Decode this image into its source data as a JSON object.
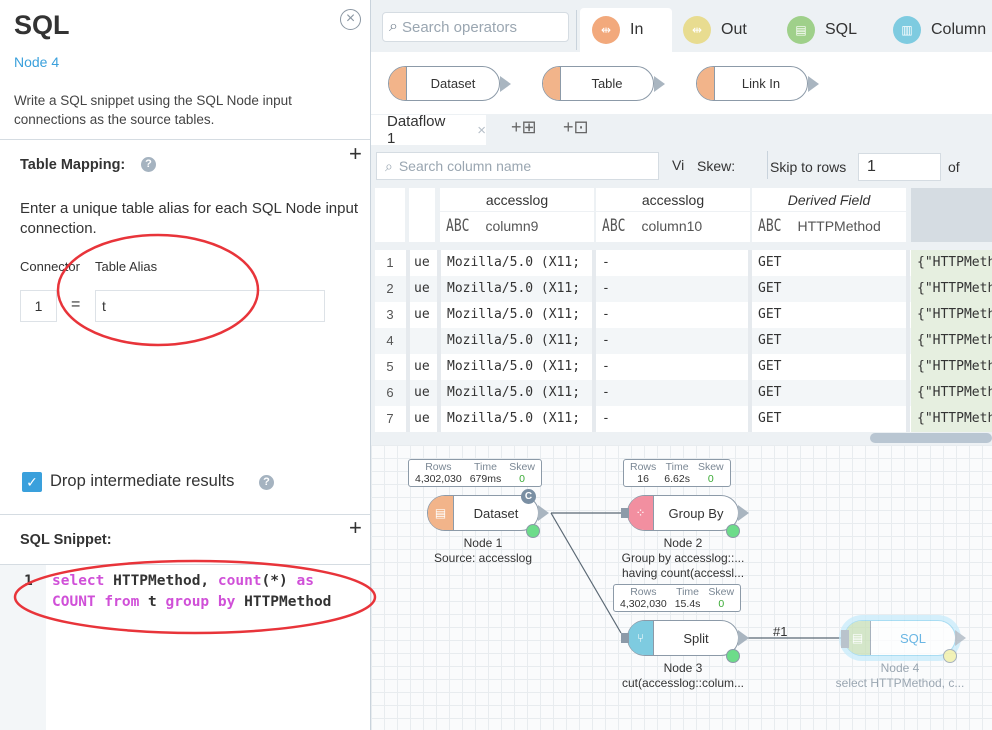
{
  "panel": {
    "title": "SQL",
    "subtitle": "Node 4",
    "description": "Write a SQL snippet using the SQL Node input connections as the source tables.",
    "table_mapping": {
      "label": "Table Mapping:",
      "instructions": "Enter a unique table alias for each SQL Node input connection.",
      "col_connector": "Connector",
      "col_alias": "Table Alias",
      "connector_value": "1",
      "equals": "=",
      "alias_value": "t"
    },
    "drop_intermediate": {
      "label": "Drop intermediate results",
      "checked": true
    },
    "snippet": {
      "label": "SQL Snippet:",
      "line_number": "1",
      "tokens": [
        {
          "t": "select",
          "k": true
        },
        {
          "t": " HTTPMethod, ",
          "k": false
        },
        {
          "t": "count",
          "k": true
        },
        {
          "t": "(*) ",
          "k": false
        },
        {
          "t": "as",
          "k": true
        },
        {
          "t": "\n",
          "k": false
        },
        {
          "t": "COUNT",
          "k": true
        },
        {
          "t": " ",
          "k": false
        },
        {
          "t": "from",
          "k": true
        },
        {
          "t": " t ",
          "k": false
        },
        {
          "t": "group",
          "k": true
        },
        {
          "t": " ",
          "k": false
        },
        {
          "t": "by",
          "k": true
        },
        {
          "t": " HTTPMethod",
          "k": false
        }
      ]
    },
    "colors": {
      "keyword": "#d050d8",
      "accent": "#3aa0dc",
      "annotation": "#e8343a"
    }
  },
  "toolbar": {
    "search_placeholder": "Search operators",
    "tabs": [
      {
        "label": "In",
        "color": "#f2a97c"
      },
      {
        "label": "Out",
        "color": "#e8dc90"
      },
      {
        "label": "SQL",
        "color": "#9fd08a"
      },
      {
        "label": "Column",
        "color": "#7ecbe0"
      }
    ]
  },
  "operators": [
    {
      "label": "Dataset"
    },
    {
      "label": "Table"
    },
    {
      "label": "Link In"
    }
  ],
  "dataflow": {
    "tab_label": "Dataflow 1"
  },
  "grid": {
    "search_placeholder": "Search column name",
    "vi": "Vi",
    "skew_label": "Skew:",
    "skip_label": "Skip to rows",
    "skip_value": "1",
    "of": "of",
    "columns": [
      {
        "source": "accesslog",
        "name": "column9",
        "type": "ABC"
      },
      {
        "source": "accesslog",
        "name": "column10",
        "type": "ABC"
      },
      {
        "source": "Derived Field",
        "name": "HTTPMethod",
        "type": "ABC"
      }
    ],
    "rows": [
      {
        "n": "1",
        "a": "ue",
        "b": "Mozilla/5.0 (X11;",
        "c": "-",
        "d": "GET",
        "e": "{\"HTTPMeth"
      },
      {
        "n": "2",
        "a": "ue",
        "b": "Mozilla/5.0 (X11;",
        "c": "-",
        "d": "GET",
        "e": "{\"HTTPMeth"
      },
      {
        "n": "3",
        "a": "ue",
        "b": "Mozilla/5.0 (X11;",
        "c": "-",
        "d": "GET",
        "e": "{\"HTTPMeth"
      },
      {
        "n": "4",
        "a": "",
        "b": "Mozilla/5.0 (X11;",
        "c": "-",
        "d": "GET",
        "e": "{\"HTTPMeth"
      },
      {
        "n": "5",
        "a": "ue",
        "b": "Mozilla/5.0 (X11;",
        "c": "-",
        "d": "GET",
        "e": "{\"HTTPMeth"
      },
      {
        "n": "6",
        "a": "ue",
        "b": "Mozilla/5.0 (X11;",
        "c": "-",
        "d": "GET",
        "e": "{\"HTTPMeth"
      },
      {
        "n": "7",
        "a": "ue",
        "b": "Mozilla/5.0 (X11;",
        "c": "-",
        "d": "GET",
        "e": "{\"HTTPMeth"
      }
    ]
  },
  "canvas": {
    "stat_headers": [
      "Rows",
      "Time",
      "Skew"
    ],
    "nodes": [
      {
        "label": "Dataset",
        "name": "Node 1",
        "desc1": "Source: accesslog",
        "desc2": "",
        "rows": "4,302,030",
        "time": "679ms",
        "skew": "0",
        "color": "#f2b48a"
      },
      {
        "label": "Group By",
        "name": "Node 2",
        "desc1": "Group by accesslog::...",
        "desc2": "having count(accessl...",
        "rows": "16",
        "time": "6.62s",
        "skew": "0",
        "color": "#f28fa0"
      },
      {
        "label": "Split",
        "name": "Node 3",
        "desc1": "cut(accesslog::colum...",
        "desc2": "",
        "rows": "4,302,030",
        "time": "15.4s",
        "skew": "0",
        "color": "#7ecbe0"
      },
      {
        "label": "SQL",
        "name": "Node 4",
        "desc1": "select HTTPMethod, c...",
        "desc2": "",
        "color": "#c8e0b8"
      }
    ],
    "edge_label": "#1",
    "badge": "C"
  }
}
